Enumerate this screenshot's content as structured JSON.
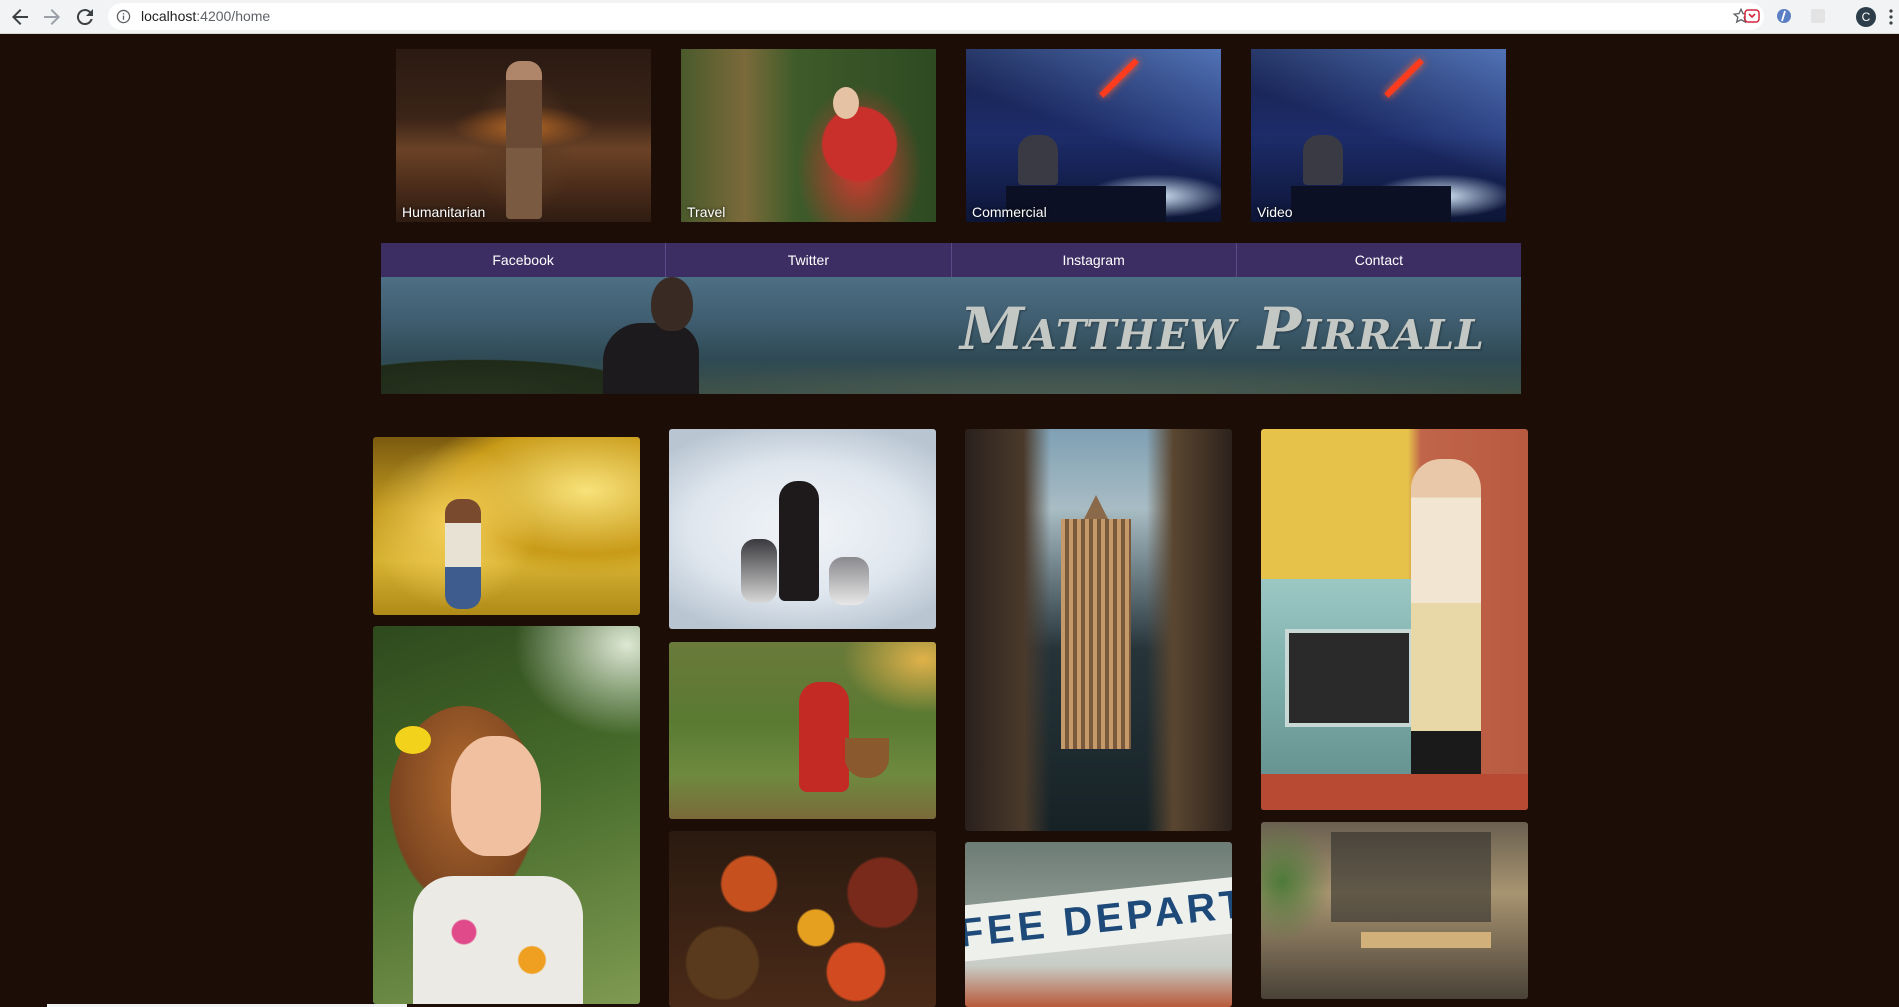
{
  "browser": {
    "url_host": "localhost",
    "url_path": ":4200/home",
    "profile_initial": "C"
  },
  "categories": [
    {
      "label": "Humanitarian"
    },
    {
      "label": "Travel"
    },
    {
      "label": "Commercial"
    },
    {
      "label": "Video"
    }
  ],
  "nav": {
    "items": [
      "Facebook",
      "Twitter",
      "Instagram",
      "Contact"
    ]
  },
  "banner": {
    "title": "Matthew Pirrall"
  },
  "gallery": {
    "depot_sign_text": "FEE DEPARTI"
  },
  "colors": {
    "page_background": "#1c0e06",
    "nav_background": "#3c2e63"
  }
}
